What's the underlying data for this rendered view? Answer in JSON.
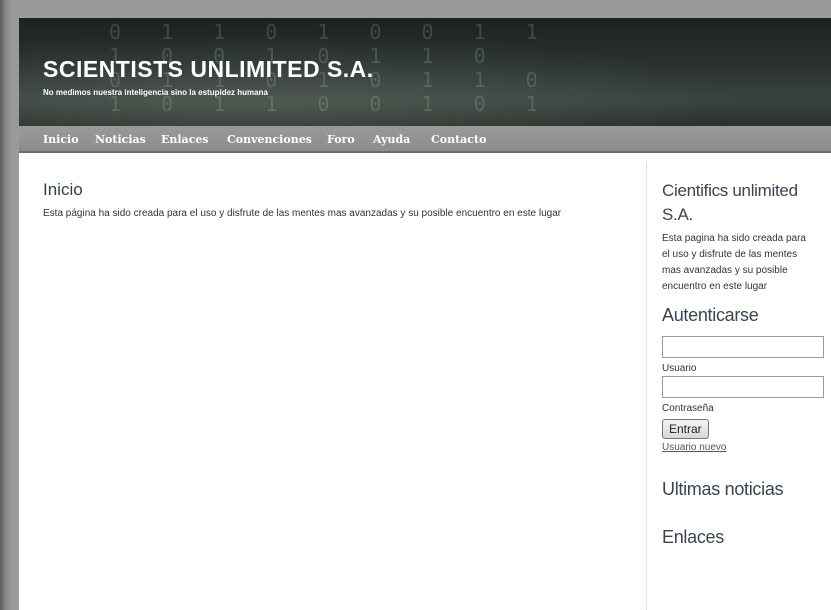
{
  "header": {
    "title": "SCIENTISTS UNLIMITED S.A.",
    "slogan": "No medimos nuestra inteligencia sino la estupidez humana",
    "background_digits": "0 1 1 0 1 0 0 1 1\n1 0 0 1 0 1 1 0\n0 1 1 0 1 0 1 1 0\n1 0 1 1 0 0 1 0 1"
  },
  "nav": {
    "items": [
      "Inicio",
      "Noticias",
      "Enlaces",
      "Convenciones",
      "Foro",
      "Ayuda",
      "Contacto"
    ]
  },
  "main": {
    "title": "Inicio",
    "text": "Esta página ha sido creada para el uso y disfrute de las mentes mas avanzadas y su posible encuentro en este lugar"
  },
  "sidebar": {
    "title": "Cientifics unlimited S.A.",
    "text": "Esta pagina ha sido creada para el uso y disfrute de las mentes mas avanzadas y su posible encuentro en este lugar",
    "auth_title": "Autenticarse",
    "user_value": "",
    "user_label": "Usuario",
    "pass_value": "",
    "pass_label": "Contraseña",
    "submit_label": "Entrar",
    "new_user_link": "Usuario nuevo",
    "news_title": "Ultimas noticias",
    "links_title": "Enlaces"
  },
  "colors": {
    "heading": "#3b4450",
    "nav_bg": "#8c8c8c",
    "header_bg": "#2c332f"
  }
}
